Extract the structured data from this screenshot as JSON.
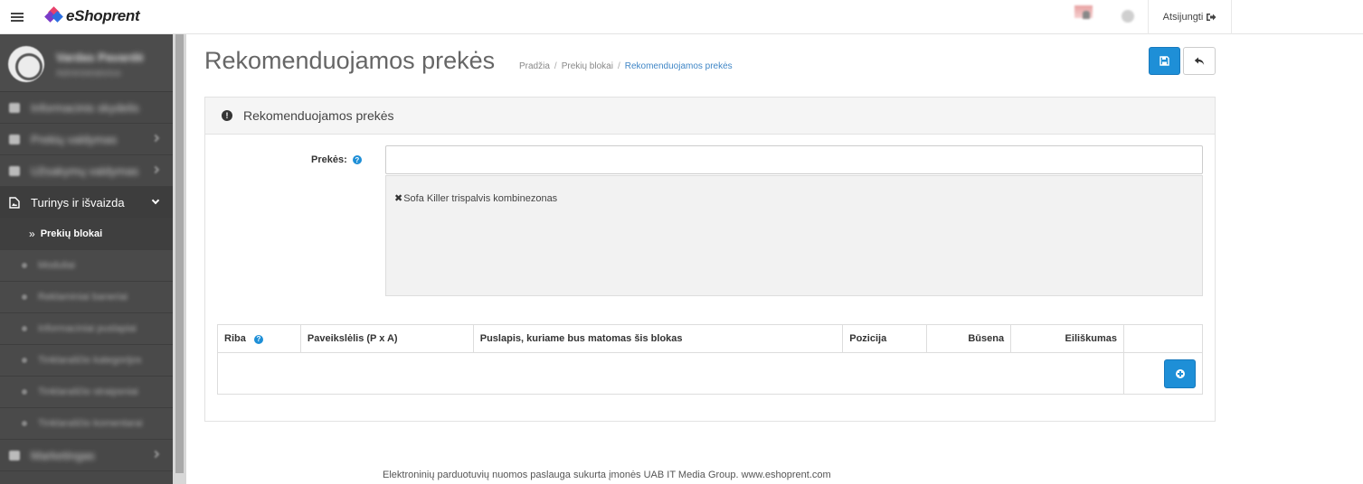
{
  "header": {
    "brand": "eShoprent",
    "logout_label": "Atsijungti",
    "brand_colors": [
      "#e8416b",
      "#7a3cc8",
      "#2d6fe0"
    ]
  },
  "sidebar": {
    "profile_name": "Vardas Pavardė",
    "profile_role": "Administratorius",
    "items": [
      {
        "label": "Informacinis skydelis",
        "icon": "dashboard-icon"
      },
      {
        "label": "Prekių valdymas",
        "icon": "tags-icon"
      },
      {
        "label": "Užsakymų valdymas",
        "icon": "cart-icon"
      },
      {
        "label": "Turinys ir išvaizda",
        "icon": "image-file-icon"
      },
      {
        "label": "Marketingas",
        "icon": "share-icon"
      }
    ],
    "subitems": [
      {
        "label": "Prekių blokai"
      },
      {
        "label": "Moduliai"
      },
      {
        "label": "Reklaminiai baneriai"
      },
      {
        "label": "Informaciniai puslapiai"
      },
      {
        "label": "Tinklaraščio kategorijos"
      },
      {
        "label": "Tinklaraščio straipsniai"
      },
      {
        "label": "Tinklaraščio komentarai"
      }
    ]
  },
  "page": {
    "title": "Rekomenduojamos prekės",
    "breadcrumb": [
      "Pradžia",
      "Prekių blokai",
      "Rekomenduojamos prekės"
    ]
  },
  "panel": {
    "heading": "Rekomenduojamos prekės",
    "products_label": "Prekės:",
    "products_input_value": "",
    "selected_products": [
      "Sofa Killer trispalvis kombinezonas"
    ]
  },
  "table": {
    "columns": [
      "Riba",
      "Paveikslėlis (P x A)",
      "Puslapis, kuriame bus matomas šis blokas",
      "Pozicija",
      "Būsena",
      "Eiliškumas"
    ],
    "rows": []
  },
  "footer": {
    "text": "Elektroninių parduotuvių nuomos paslauga sukurta įmonės UAB IT Media Group. www.eshoprent.com"
  }
}
